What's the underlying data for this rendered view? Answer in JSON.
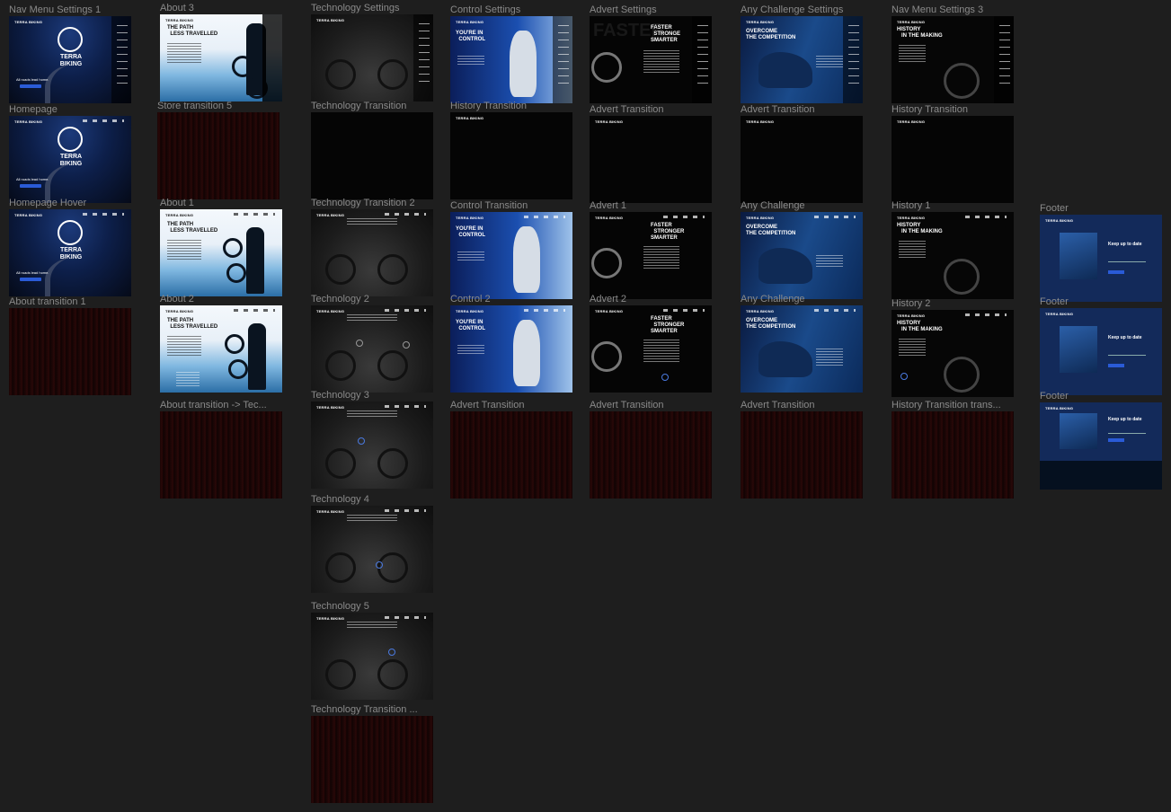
{
  "canvas": {
    "background": "#1e1e1e",
    "label_color": "#8a8a8a"
  },
  "frames": {
    "nav_menu_settings_1": "Nav Menu Settings 1",
    "homepage": "Homepage",
    "homepage_hover": "Homepage Hover",
    "about_transition_1": "About transition 1",
    "about_3": "About 3",
    "store_transition_5": "Store  transition 5",
    "about_1": "About 1",
    "about_2": "About 2",
    "about_transition_tec": "About transition -> Tec...",
    "technology_settings": "Technology Settings",
    "technology_transition": "Technology Transition",
    "technology_transition_2": "Technology Transition 2",
    "technology_2": "Technology 2",
    "technology_3": "Technology 3",
    "technology_4": "Technology 4",
    "technology_5": "Technology 5",
    "technology_transition_end": "Technology Transition ...",
    "control_settings": "Control Settings",
    "history_transition": "History Transition",
    "control_transition": "Control Transition",
    "control_2": "Control 2",
    "advert_transition_a": "Advert Transition",
    "advert_settings": "Advert Settings",
    "advert_transition_b": "Advert Transition",
    "advert_1": "Advert 1",
    "advert_2": "Advert 2",
    "advert_transition_c": "Advert Transition",
    "any_challenge_settings": "Any Challenge Settings",
    "advert_transition_d": "Advert Transition",
    "any_challenge": "Any Challenge",
    "any_challenge_2": "Any Challenge",
    "advert_transition_e": "Advert Transition",
    "nav_menu_settings_3": "Nav Menu Settings 3",
    "history_transition_2": "History Transition",
    "history_1": "History 1",
    "history_2": "History 2",
    "history_transition_trans": "History Transition trans...",
    "footer_1": "Footer",
    "footer_2": "Footer",
    "footer_3": "Footer"
  },
  "content": {
    "brand": "TERRA BIKING",
    "brand_line1": "TERRA",
    "brand_line2": "BIKING",
    "tagline": "All roads lead home.",
    "about_heading_1": "THE PATH",
    "about_heading_2": "LESS TRAVELLED",
    "control_heading_1": "YOU'RE IN",
    "control_heading_2": "CONTROL",
    "advert_heading_1": "FASTER",
    "advert_heading_2": "STRONGER",
    "advert_heading_3": "SMARTER",
    "advert_heading_2_settings": "STRONGE",
    "challenge_heading_1": "OVERCOME",
    "challenge_heading_2": "THE COMPETITION",
    "history_heading_1": "HISTORY",
    "history_heading_2": "IN THE MAKING",
    "footer_title": "Keep up to date"
  }
}
